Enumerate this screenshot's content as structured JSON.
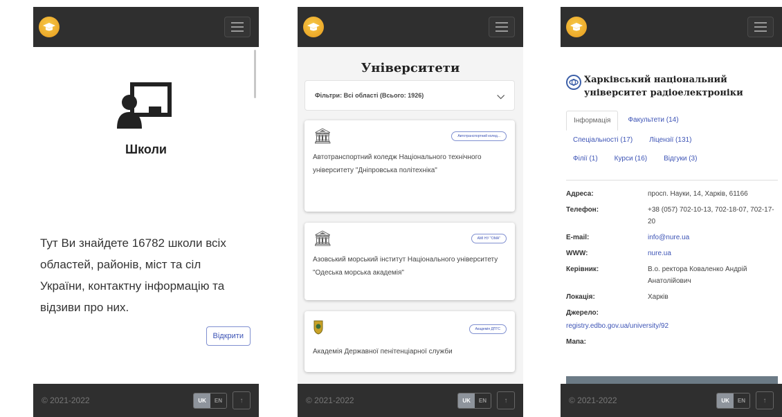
{
  "screens": {
    "schools": {
      "title": "Школи",
      "description": "Тут Ви знайдете 16782 школи всіх областей, районів, міст та сіл України, контактну інформацію та відзиви про них.",
      "open_button": "Відкрити"
    },
    "universities": {
      "title": "Університети",
      "filter": "Фільтри: Всі області (Всього: 1926)",
      "cards": [
        {
          "badge": "Автотранспортний колед...",
          "name": "Автотранспортний коледж Національного технічного університету \"Дніпровська політехніка\""
        },
        {
          "badge": "АМІ НУ \"ОМА\"",
          "name": "Азовський морський інститут Національного університету \"Одеська морська академія\""
        },
        {
          "badge": "Академія ДПТС",
          "name": "Академія Державної пенітенціарної служби"
        }
      ]
    },
    "university_detail": {
      "name": "Харківський національний університет радіоелектроніки",
      "tabs_row1": [
        "Інформація",
        "Факультети (14)"
      ],
      "tabs_row2": [
        "Спеціальності (17)",
        "Ліцензії (131)"
      ],
      "tabs_row3": [
        "Філії (1)",
        "Курси (16)",
        "Відгуки (3)"
      ],
      "info": [
        {
          "key": "Адреса:",
          "value": "просп. Науки, 14, Харків, 61166"
        },
        {
          "key": "Телефон:",
          "value": "+38 (057) 702-10-13, 702-18-07, 702-17-20"
        },
        {
          "key": "E-mail:",
          "value": "info@nure.ua"
        },
        {
          "key": "WWW:",
          "value": "nure.ua"
        },
        {
          "key": "Керівник:",
          "value": "В.о. ректора Коваленко Андрій Анатолійович"
        },
        {
          "key": "Локація:",
          "value": "Харків"
        }
      ],
      "source_label": "Джерело:",
      "source_link": "registry.edbo.gov.ua/university/92",
      "map_label": "Мапа:"
    }
  },
  "footer": {
    "copyright": "© 2021-2022",
    "lang_uk": "UK",
    "lang_en": "EN",
    "up": "↑"
  },
  "colors": {
    "navbar": "#2f2f2f",
    "accent": "#3c53b5",
    "logo": "#f0b433"
  }
}
